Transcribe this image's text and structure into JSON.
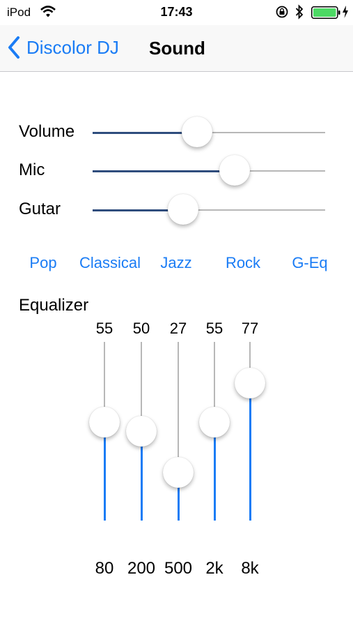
{
  "status_bar": {
    "carrier": "iPod",
    "time": "17:43",
    "icons": [
      "wifi-icon",
      "rotation-lock-icon",
      "bluetooth-icon",
      "battery-icon",
      "charging-icon"
    ],
    "battery_color": "#4cd964"
  },
  "nav": {
    "back_label": "Discolor DJ",
    "title": "Sound"
  },
  "sliders": [
    {
      "label": "Volume",
      "value": 0.45
    },
    {
      "label": "Mic",
      "value": 0.61
    },
    {
      "label": "Gutar",
      "value": 0.39
    }
  ],
  "presets": [
    "Pop",
    "Classical",
    "Jazz",
    "Rock",
    "G-Eq"
  ],
  "equalizer": {
    "title": "Equalizer",
    "bands": [
      {
        "freq": "80",
        "value": "55",
        "level": 0.55
      },
      {
        "freq": "200",
        "value": "50",
        "level": 0.5
      },
      {
        "freq": "500",
        "value": "27",
        "level": 0.27
      },
      {
        "freq": "2k",
        "value": "55",
        "level": 0.55
      },
      {
        "freq": "8k",
        "value": "77",
        "level": 0.77
      }
    ]
  },
  "colors": {
    "accent": "#1a7cf5",
    "slider_fill": "#2f4d7d",
    "track": "#b7b7b7"
  }
}
